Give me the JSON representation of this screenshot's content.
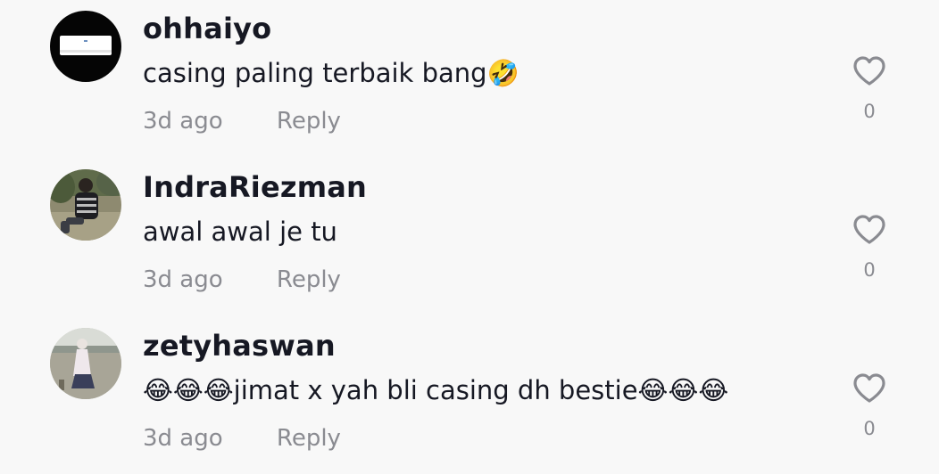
{
  "comments": [
    {
      "username": "ohhaiyo",
      "text": "casing paling terbaik bang🤣",
      "time": "3d ago",
      "reply_label": "Reply",
      "likes": "0",
      "avatar_icon": "air-conditioner-avatar"
    },
    {
      "username": "IndraRiezman",
      "text": "awal awal je tu",
      "time": "3d ago",
      "reply_label": "Reply",
      "likes": "0",
      "avatar_icon": "person-sitting-photo-avatar"
    },
    {
      "username": "zetyhaswan",
      "text": "😂😂😂jimat x yah bli casing dh bestie😂😂😂",
      "time": "3d ago",
      "reply_label": "Reply",
      "likes": "0",
      "avatar_icon": "person-beach-photo-avatar"
    }
  ],
  "colors": {
    "background": "#f8f8f8",
    "username": "#161823",
    "meta": "#8a8b91",
    "heart_outline": "#8a8b91"
  }
}
